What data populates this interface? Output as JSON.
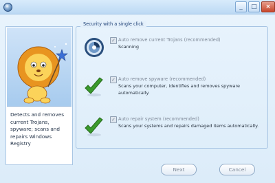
{
  "window": {
    "minimize_glyph": "_",
    "maximize_glyph": "□",
    "close_glyph": "×"
  },
  "sidebar": {
    "description": "Detects and removes current Trojans, spyware; scans and repairs Windows Registry",
    "mascot": "lion-mascot"
  },
  "group": {
    "title": "Security with a single click"
  },
  "options": [
    {
      "label": "Auto remove current Trojans (recommended)",
      "description": "Scanning",
      "checked": true,
      "icon": "scanning-disc-icon"
    },
    {
      "label": "Auto remove spyware (recommended)",
      "description": "Scans your computer, identifies and removes spyware automatically.",
      "checked": true,
      "icon": "green-check-icon"
    },
    {
      "label": "Auto repair system (recommended)",
      "description": "Scans your systems and repairs  damaged items automatically.",
      "checked": true,
      "icon": "green-check-icon"
    }
  ],
  "buttons": {
    "next": "Next",
    "cancel": "Cancel"
  },
  "colors": {
    "accent": "#2c5f9a",
    "check_green": "#3a9a2c"
  }
}
